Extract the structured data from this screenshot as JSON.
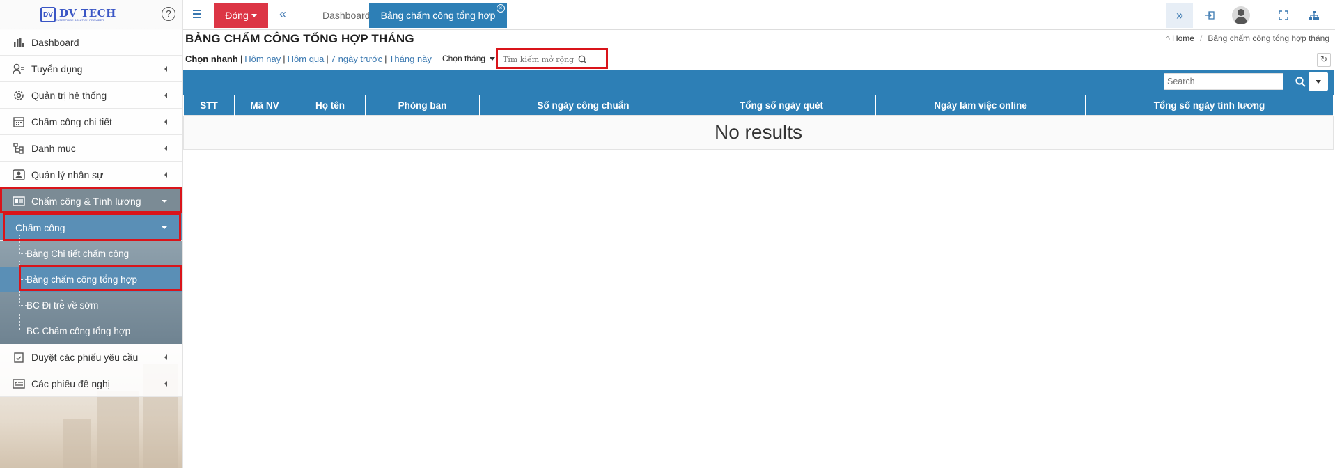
{
  "app": {
    "logo_text": "DV TECH",
    "logo_sub": "ENTERPRISE SOLUTION PROVIDER",
    "help_glyph": "?"
  },
  "sidebar": {
    "items": [
      {
        "label": "Dashboard",
        "icon": "bar-chart-icon"
      },
      {
        "label": "Tuyển dụng",
        "icon": "person-search-icon"
      },
      {
        "label": "Quản trị hệ thống",
        "icon": "gear-icon"
      },
      {
        "label": "Chấm công chi tiết",
        "icon": "calendar-icon"
      },
      {
        "label": "Danh mục",
        "icon": "tree-icon"
      },
      {
        "label": "Quản lý nhân sự",
        "icon": "user-card-icon"
      },
      {
        "label": "Chấm công & Tính lương",
        "icon": "id-card-icon"
      },
      {
        "label": "Chấm công",
        "icon": ""
      },
      {
        "label": "Duyệt các phiếu yêu cầu",
        "icon": "clipboard-check-icon"
      },
      {
        "label": "Các phiếu đề nghị",
        "icon": "list-form-icon"
      }
    ],
    "subitems": [
      {
        "label": "Bảng Chi tiết chấm công"
      },
      {
        "label": "Bảng chấm công tổng hợp"
      },
      {
        "label": "BC Đi trễ về sớm"
      },
      {
        "label": "BC Chấm công tổng hợp"
      }
    ]
  },
  "topbar": {
    "close_label": "Đóng",
    "tabs": [
      {
        "label": "Dashboard"
      },
      {
        "label": "Bảng chấm công tổng hợp"
      }
    ]
  },
  "page": {
    "title": "BẢNG CHẤM CÔNG TỔNG HỢP THÁNG",
    "breadcrumb": {
      "home": "Home",
      "current": "Bảng chấm công tổng hợp tháng"
    }
  },
  "filter": {
    "quick_label": "Chọn nhanh",
    "today": "Hôm nay",
    "yesterday": "Hôm qua",
    "last7": "7 ngày trước",
    "this_month": "Tháng này",
    "month_select": "Chọn tháng",
    "search_placeholder": "Tìm kiếm mở rộng"
  },
  "table": {
    "search_placeholder": "Search",
    "columns": [
      "STT",
      "Mã NV",
      "Họ tên",
      "Phòng ban",
      "Số ngày công chuẩn",
      "Tổng số ngày quét",
      "Ngày làm việc online",
      "Tổng số ngày tính lương"
    ],
    "empty_text": "No results"
  },
  "colors": {
    "accent": "#2d7fb6",
    "danger": "#dc3545",
    "highlight": "#d9141a",
    "sidebar_group": "#7b8b95"
  }
}
